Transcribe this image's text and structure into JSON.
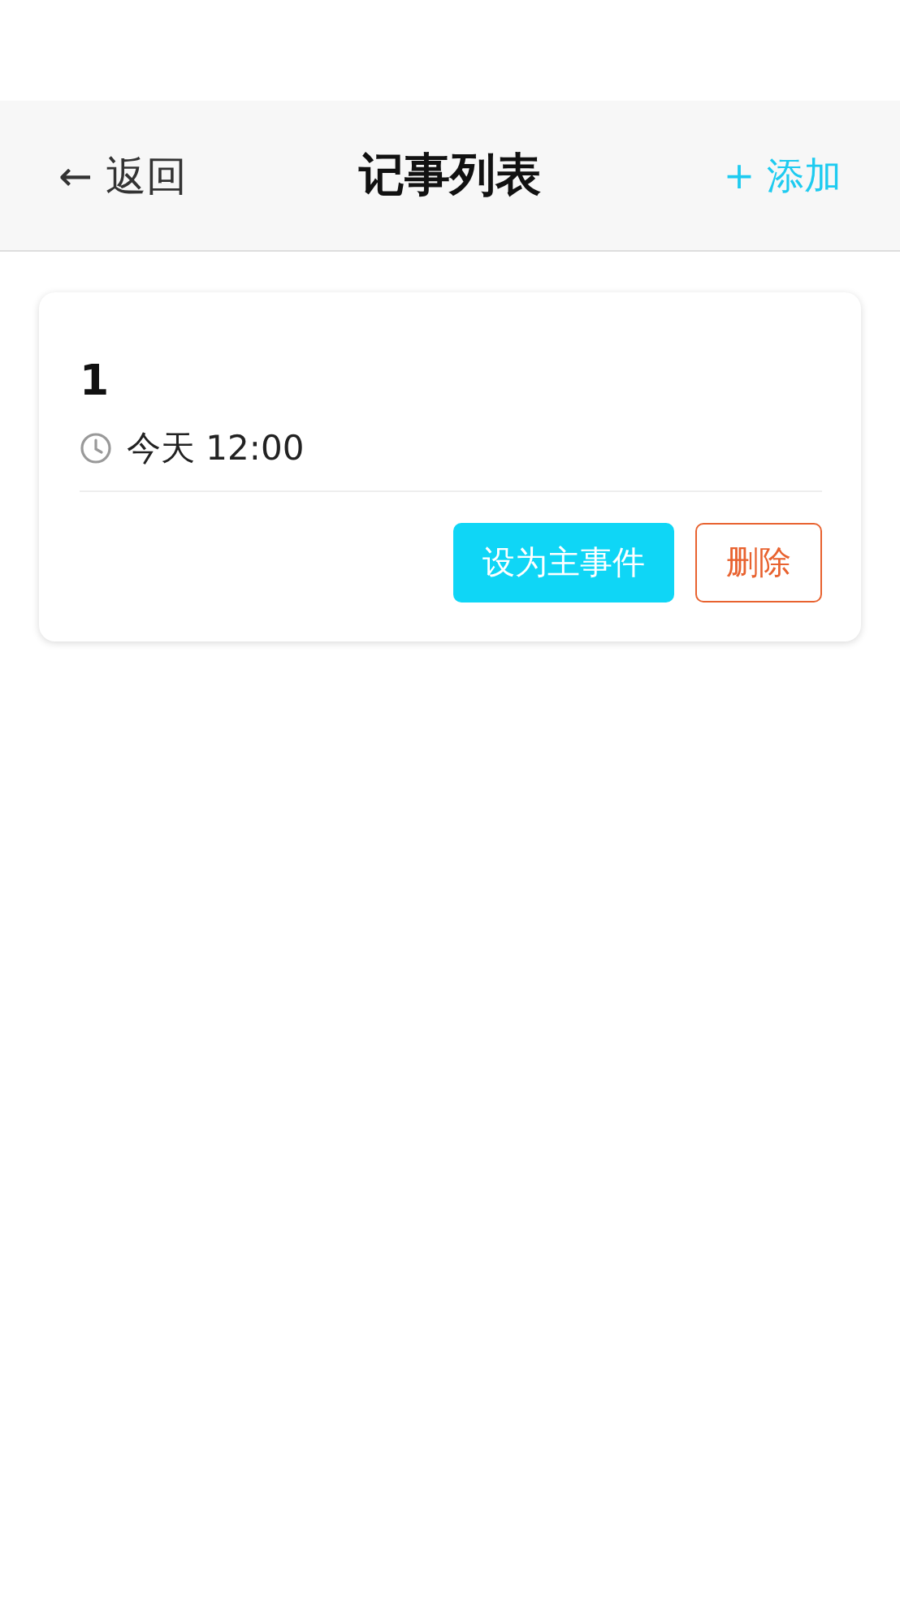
{
  "header": {
    "back": "← 返回",
    "title": "记事列表",
    "add": "+ 添加"
  },
  "notes": [
    {
      "title": "1",
      "time": "今天 12:00",
      "buttons": [
        {
          "label": "设为主事件",
          "kind": "primary"
        },
        {
          "label": "删除",
          "kind": "danger"
        }
      ]
    }
  ]
}
